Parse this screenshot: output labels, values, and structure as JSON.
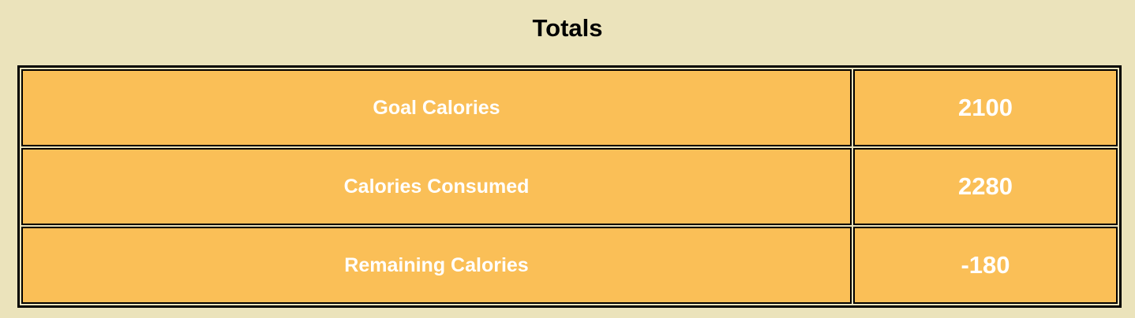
{
  "header": {
    "title": "Totals"
  },
  "totals": {
    "rows": [
      {
        "label": "Goal Calories",
        "value": "2100"
      },
      {
        "label": "Calories Consumed",
        "value": "2280"
      },
      {
        "label": "Remaining Calories",
        "value": "-180"
      }
    ]
  },
  "colors": {
    "background": "#ebe3bb",
    "cell_fill": "#fabf57",
    "border": "#000000",
    "cell_text": "#ffffff",
    "title_text": "#000000"
  }
}
